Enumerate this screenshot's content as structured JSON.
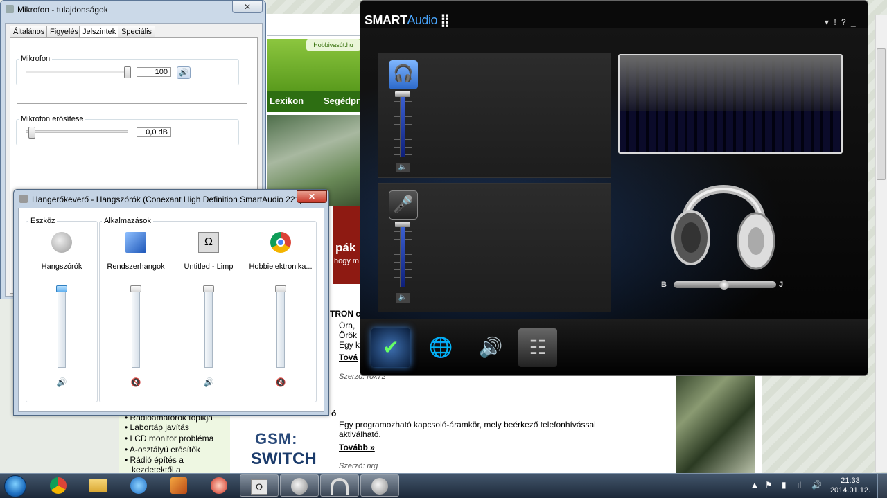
{
  "browser": {
    "site_badge": "Hobbivasút.hu",
    "nav_items": [
      "Lexikon",
      "Segédpr"
    ],
    "red_headline": "pák l",
    "red_sub": "hogy m",
    "article1_lines": [
      "TRON c",
      "Óra,",
      "Örök",
      "Egy k",
      "Tová"
    ],
    "article1_author": "Szerző: rox72",
    "article2_title": "ó",
    "article2_text": "Egy programozható kapcsoló-áramkör, mely beérkező telefonhívással aktiválható.",
    "article2_more": "Tovább »",
    "article2_author": "Szerző: nrg",
    "gsm_logo": "GSM:",
    "gsm_logo2": "SWITCH",
    "sidebar_items": [
      "Rádióamatőrök topikja",
      "Labortáp javítás",
      "LCD monitor probléma",
      "A-osztályú erősítők",
      "Rádió építés a",
      "kezdetektől a"
    ]
  },
  "mic_props": {
    "title": "Mikrofon - tulajdonságok",
    "close": "✕",
    "tabs": [
      "Általános",
      "Figyelés",
      "Jelszintek",
      "Speciális"
    ],
    "selected_tab": "Jelszintek",
    "group1_label": "Mikrofon",
    "group1_value": "100",
    "group1_level": 100,
    "group2_label": "Mikrofon erősítése",
    "group2_value": "0,0 dB",
    "group2_level": 0
  },
  "mixer": {
    "title": "Hangerőkeverő - Hangszórók (Conexant High Definition SmartAudio 221)",
    "close": "✕",
    "device_header": "Eszköz",
    "apps_header": "Alkalmazások",
    "channels": [
      {
        "name": "Hangszórók",
        "icon": "speaker-icon",
        "muted": false
      },
      {
        "name": "Rendszerhangok",
        "icon": "system-sounds-icon",
        "muted": true
      },
      {
        "name": "Untitled - Limp",
        "icon": "omega-icon",
        "muted": false
      },
      {
        "name": "Hobbielektronika...",
        "icon": "chrome-icon",
        "muted": true
      }
    ]
  },
  "smartaudio": {
    "logo_main": "SMART",
    "logo_accent": "Audio",
    "controls": "▾ ! ? _ X",
    "balance_left": "B",
    "balance_right": "J",
    "accent_color": "#4aa7ff"
  },
  "taskbar": {
    "apps": [
      "chrome-icon",
      "folder-icon",
      "itunes-icon",
      "winamp-icon",
      "ccleaner-icon",
      "omega-icon",
      "speaker-icon",
      "headphones-icon",
      "speaker-icon"
    ],
    "time": "21:33",
    "date": "2014.01.12."
  }
}
